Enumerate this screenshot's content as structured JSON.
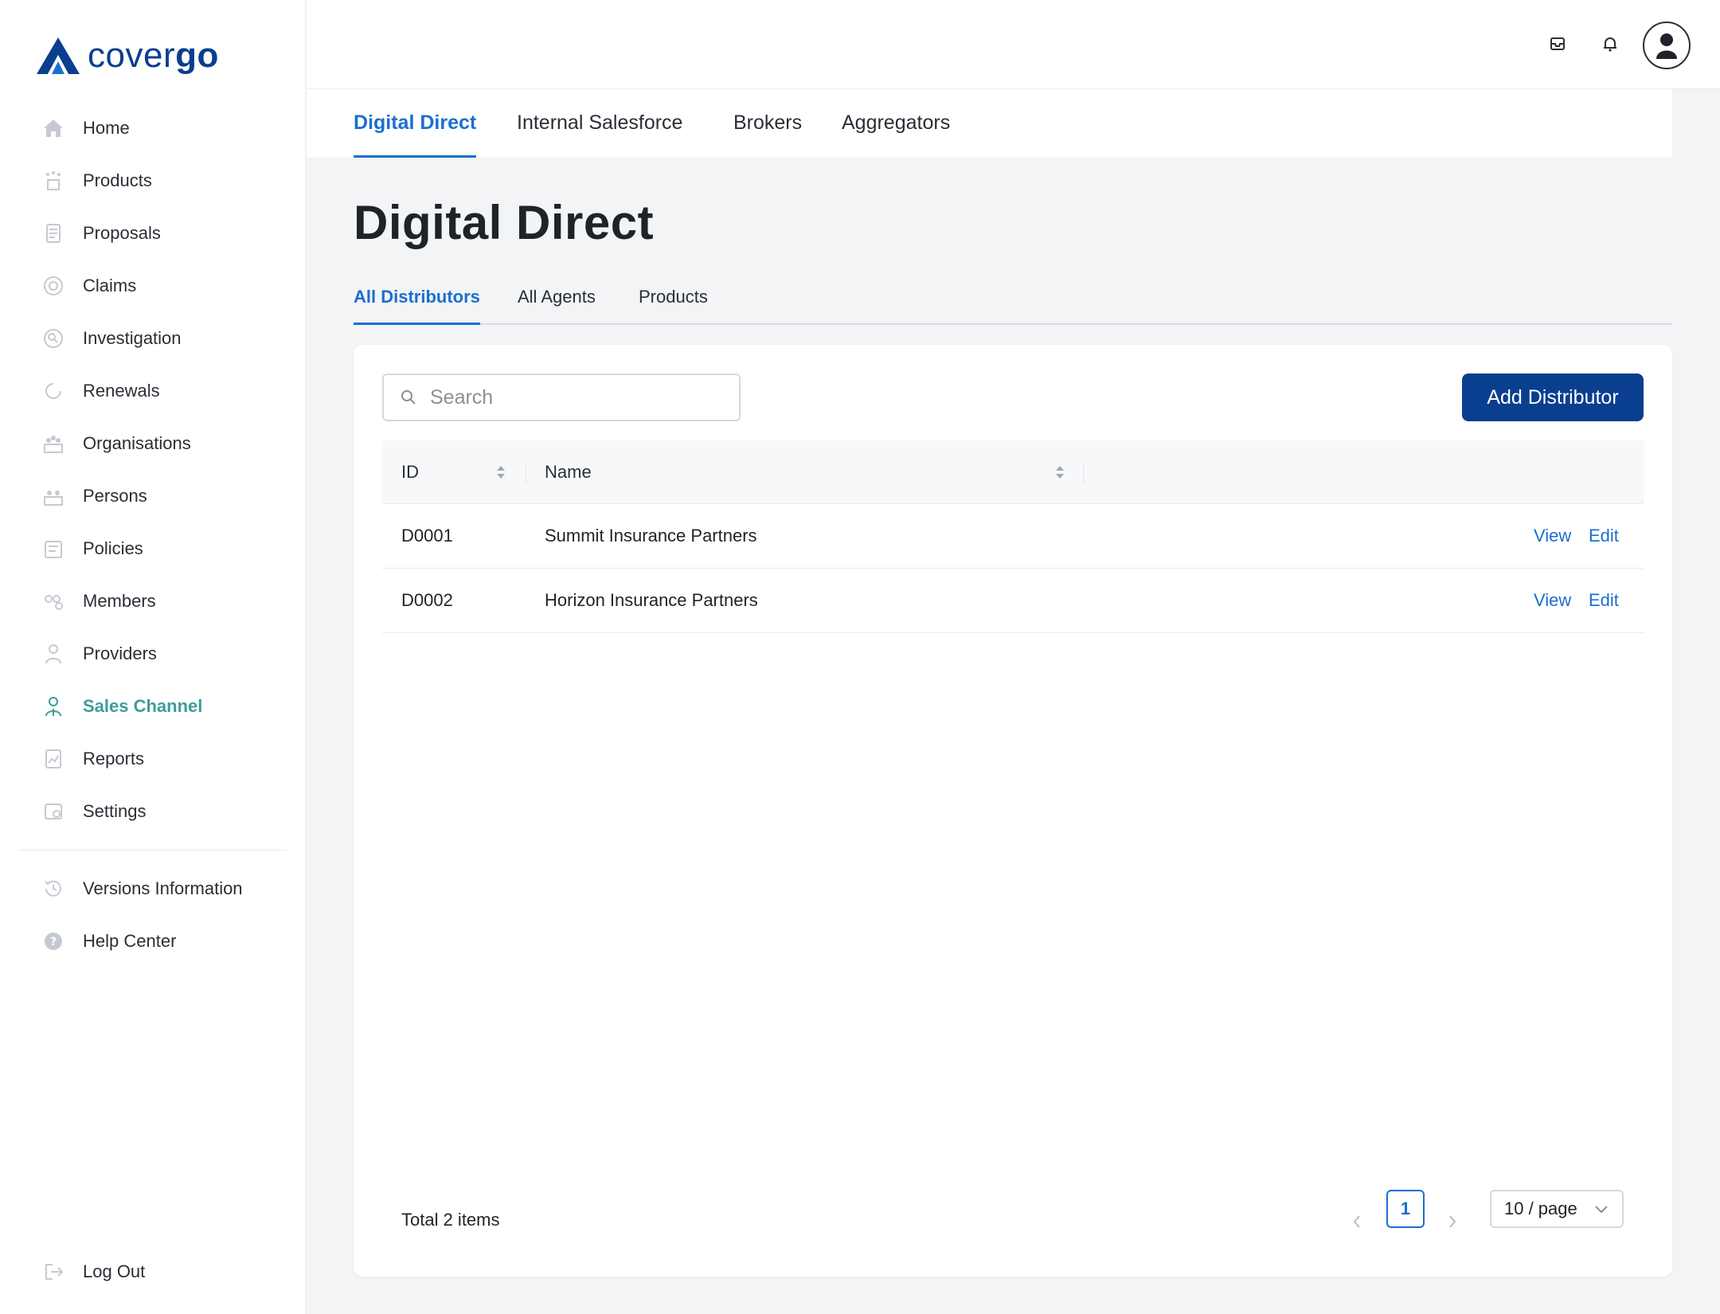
{
  "brand": {
    "logo_regular": "cover",
    "logo_bold": "go",
    "primary_color": "#0a3e8f",
    "accent_color": "#1b6fd0",
    "active_nav_color": "#3b9e9a"
  },
  "sidebar": {
    "items": [
      {
        "label": "Home",
        "icon": "home-icon"
      },
      {
        "label": "Products",
        "icon": "products-icon"
      },
      {
        "label": "Proposals",
        "icon": "proposals-icon"
      },
      {
        "label": "Claims",
        "icon": "claims-icon"
      },
      {
        "label": "Investigation",
        "icon": "investigation-icon"
      },
      {
        "label": "Renewals",
        "icon": "renewals-icon"
      },
      {
        "label": "Organisations",
        "icon": "organisations-icon"
      },
      {
        "label": "Persons",
        "icon": "persons-icon"
      },
      {
        "label": "Policies",
        "icon": "policies-icon"
      },
      {
        "label": "Members",
        "icon": "members-icon"
      },
      {
        "label": "Providers",
        "icon": "providers-icon"
      },
      {
        "label": "Sales Channel",
        "icon": "sales-channel-icon",
        "active": true
      },
      {
        "label": "Reports",
        "icon": "reports-icon"
      },
      {
        "label": "Settings",
        "icon": "settings-icon"
      }
    ],
    "secondary": [
      {
        "label": "Versions Information",
        "icon": "history-icon"
      },
      {
        "label": "Help Center",
        "icon": "help-icon"
      }
    ],
    "logout_label": "Log Out"
  },
  "topbar": {
    "icons": [
      "inbox-icon",
      "bell-icon",
      "user-avatar"
    ]
  },
  "main_tabs": [
    "Digital Direct",
    "Internal Salesforce",
    "Brokers",
    "Aggregators"
  ],
  "page": {
    "title": "Digital Direct"
  },
  "sub_tabs": [
    "All Distributors",
    "All Agents",
    "Products"
  ],
  "search": {
    "placeholder": "Search",
    "value": ""
  },
  "add_button_label": "Add Distributor",
  "table": {
    "columns": [
      "ID",
      "Name"
    ],
    "rows": [
      {
        "id": "D0001",
        "name": "Summit Insurance Partners",
        "view": "View",
        "edit": "Edit"
      },
      {
        "id": "D0002",
        "name": "Horizon Insurance Partners",
        "view": "View",
        "edit": "Edit"
      }
    ]
  },
  "pagination": {
    "total_text": "Total 2 items",
    "current_page": "1",
    "page_size": "10 / page"
  }
}
